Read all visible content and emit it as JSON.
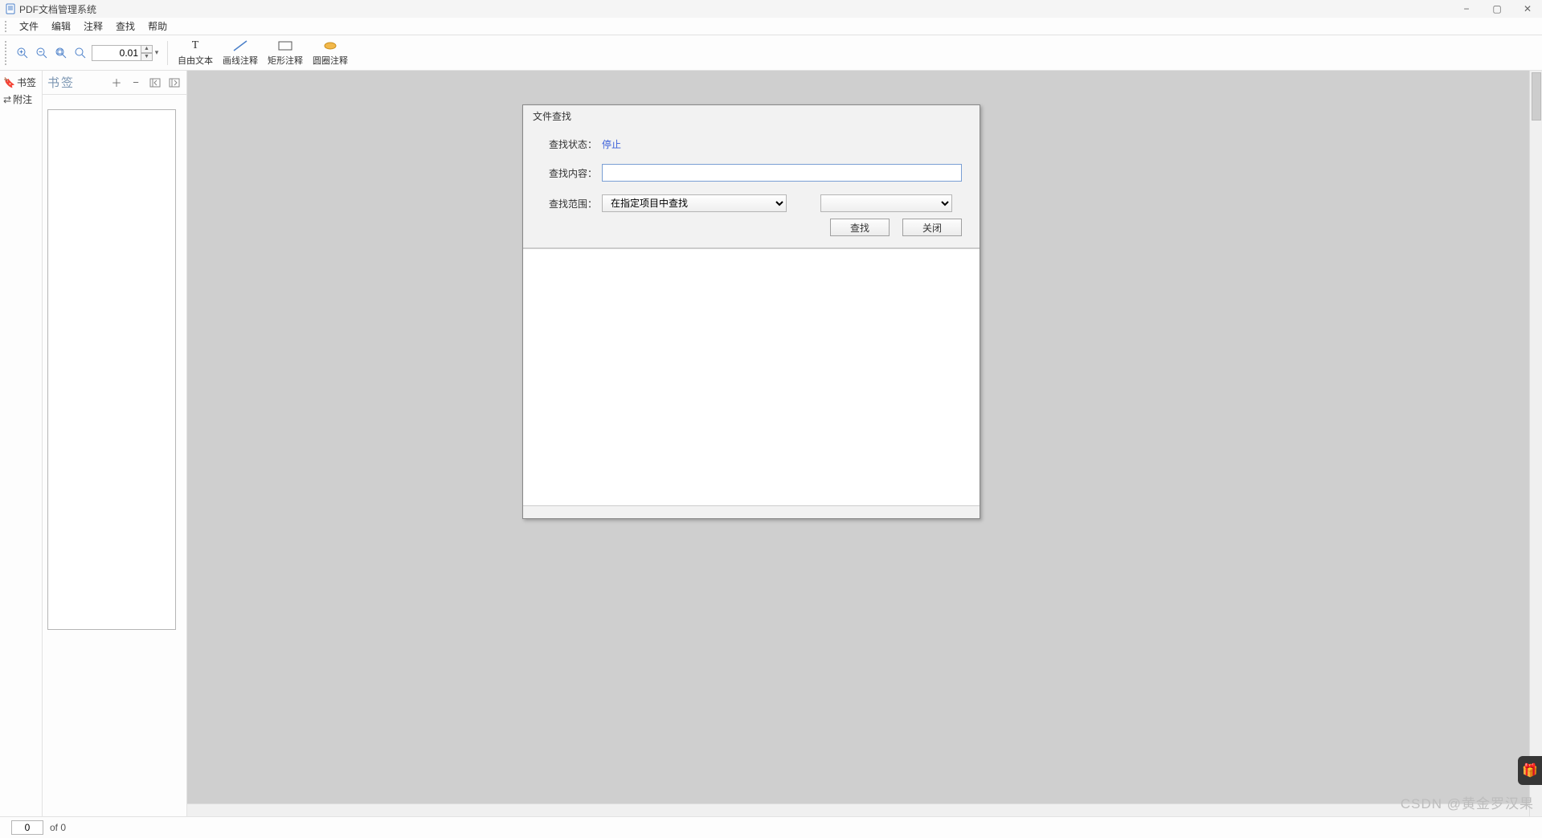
{
  "app": {
    "title": "PDF文档管理系统"
  },
  "menu": {
    "file": "文件",
    "edit": "编辑",
    "annotate": "注释",
    "find": "查找",
    "help": "帮助"
  },
  "toolbar": {
    "zoom_value": "0.01",
    "free_text": "自由文本",
    "line_annot": "画线注释",
    "rect_annot": "矩形注释",
    "ellipse_annot": "圆圈注释"
  },
  "side_strip": {
    "bookmarks": "书签",
    "attachments": "附注"
  },
  "side_panel": {
    "title": "书签"
  },
  "dialog": {
    "title": "文件查找",
    "state_label": "查找状态：",
    "state_value": "停止",
    "content_label": "查找内容：",
    "content_value": "",
    "scope_label": "查找范围：",
    "scope_value": "在指定项目中查找",
    "scope2_value": "",
    "btn_search": "查找",
    "btn_close": "关闭"
  },
  "statusbar": {
    "page_value": "0",
    "page_of": "of 0"
  },
  "watermark": "CSDN @黄金罗汉果"
}
